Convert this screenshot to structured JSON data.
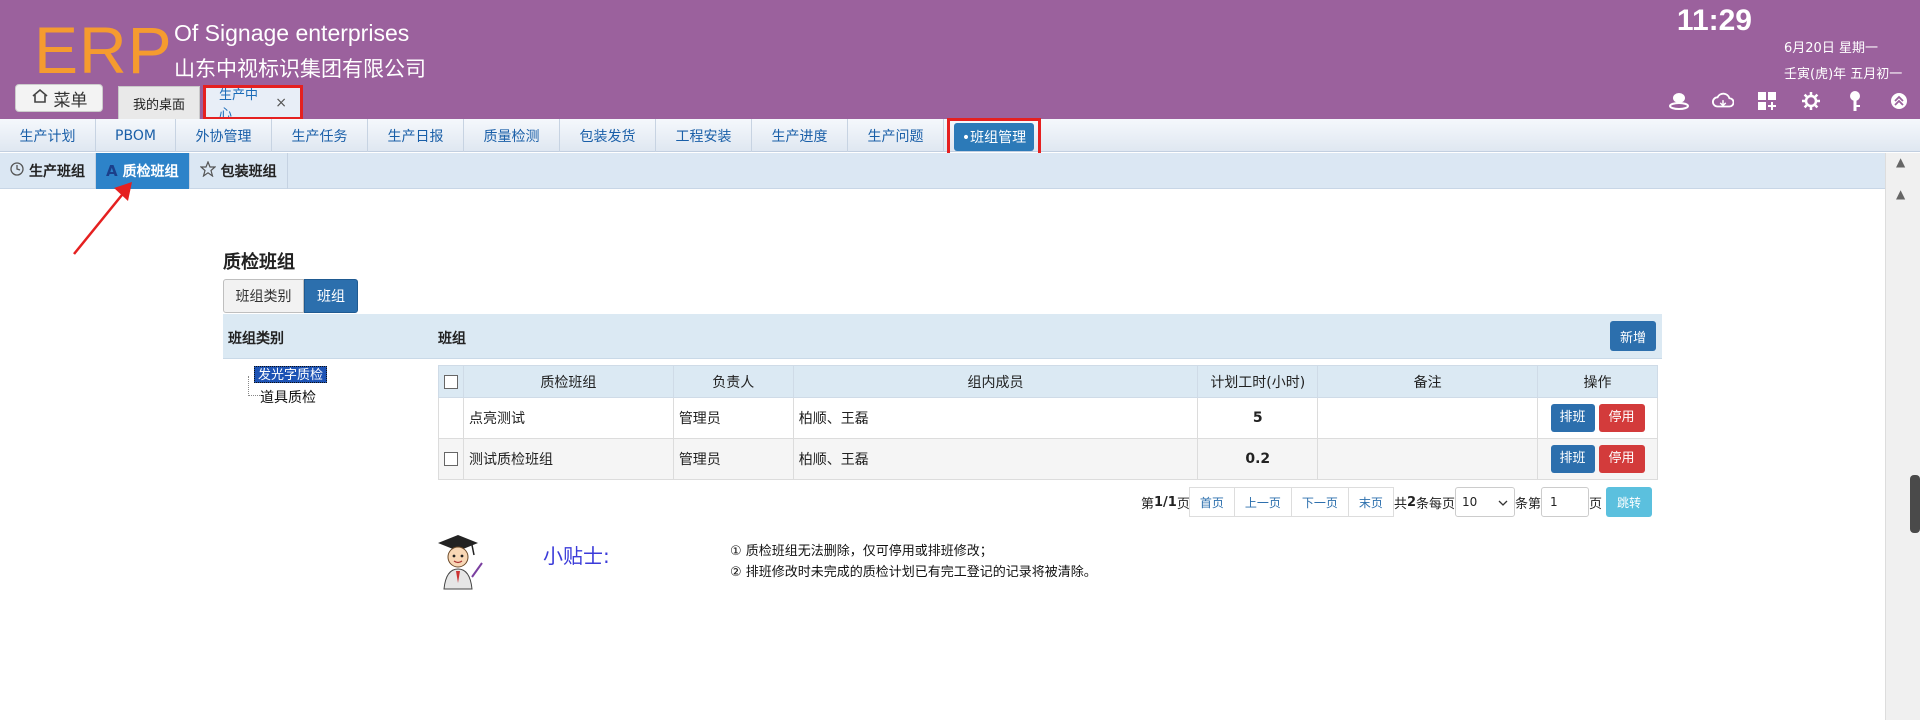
{
  "header": {
    "logo": "ERP",
    "company_en": "Of Signage enterprises",
    "company_cn": "山东中视标识集团有限公司",
    "clock": "11:29",
    "date": "6月20日 星期一",
    "lunar": "壬寅(虎)年 五月初一",
    "menu_label": "菜单",
    "tabs": [
      {
        "label": "我的桌面"
      },
      {
        "label": "生产中心",
        "close": "×"
      }
    ],
    "icons": [
      "user-icon",
      "cloud-icon",
      "apps-icon",
      "gear-icon",
      "key-icon",
      "collapse-icon"
    ],
    "accent": "#9b619d"
  },
  "nav": {
    "items": [
      {
        "label": "生产计划",
        "w": 96
      },
      {
        "label": "PBOM",
        "w": 80
      },
      {
        "label": "外协管理",
        "w": 96
      },
      {
        "label": "生产任务",
        "w": 96
      },
      {
        "label": "生产日报",
        "w": 96
      },
      {
        "label": "质量检测",
        "w": 96
      },
      {
        "label": "包装发货",
        "w": 96
      },
      {
        "label": "工程安装",
        "w": 96
      },
      {
        "label": "生产进度",
        "w": 96
      },
      {
        "label": "生产问题",
        "w": 96
      }
    ],
    "active": "•班组管理"
  },
  "subtabs": [
    {
      "label": "生产班组",
      "icon": "clock-icon"
    },
    {
      "label": "质检班组",
      "icon": "a-icon"
    },
    {
      "label": "包装班组",
      "icon": "star-icon"
    }
  ],
  "page": {
    "title": "质检班组",
    "seg_category": "班组类别",
    "seg_group": "班组",
    "panel_left": "班组类别",
    "panel_right": "班组",
    "add_button": "新增"
  },
  "tree": {
    "nodes": [
      "发光字质检",
      "道具质检"
    ]
  },
  "table": {
    "headers": [
      "质检班组",
      "负责人",
      "组内成员",
      "计划工时(小时)",
      "备注",
      "操作"
    ],
    "rows": [
      {
        "name": "点亮测试",
        "owner": "管理员",
        "members": "柏顺、王磊",
        "hours": "5",
        "remark": "",
        "has_checkbox": false
      },
      {
        "name": "测试质检班组",
        "owner": "管理员",
        "members": "柏顺、王磊",
        "hours": "0.2",
        "remark": "",
        "has_checkbox": true
      }
    ],
    "btn_schedule": "排班",
    "btn_disable": "停用"
  },
  "pager": {
    "page_info_pre": "第",
    "page_info": "1/1",
    "page_info_post": "页",
    "first": "首页",
    "prev": "上一页",
    "next": "下一页",
    "last": "末页",
    "total_pre": "共",
    "total": "2",
    "total_post": "条每页",
    "per_page": "10",
    "jump_pre": "条第",
    "jump_value": "1",
    "jump_post": "页",
    "jump_button": "跳转"
  },
  "tips": {
    "title": "小贴士:",
    "line1": "① 质检班组无法删除，仅可停用或排班修改；",
    "line2": "② 排班修改时未完成的质检计划已有完工登记的记录将被清除。"
  }
}
